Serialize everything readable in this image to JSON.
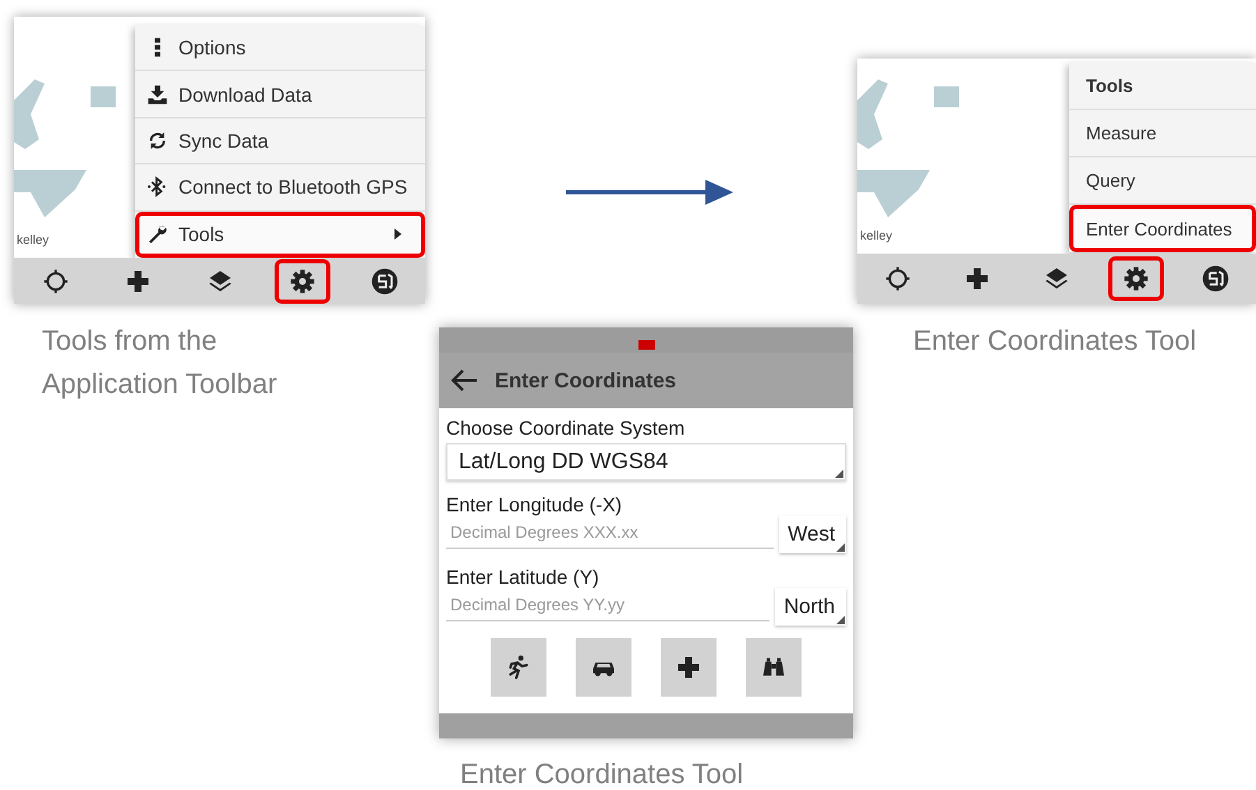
{
  "left_panel": {
    "map_label": "kelley",
    "menu": [
      {
        "kind": "options",
        "label": "Options",
        "highlighted": false,
        "submenu": false
      },
      {
        "kind": "download",
        "label": "Download Data",
        "highlighted": false,
        "submenu": false
      },
      {
        "kind": "sync",
        "label": "Sync Data",
        "highlighted": false,
        "submenu": false
      },
      {
        "kind": "bluetooth",
        "label": "Connect to Bluetooth GPS",
        "highlighted": false,
        "submenu": false
      },
      {
        "kind": "tools",
        "label": "Tools",
        "highlighted": true,
        "submenu": true
      }
    ],
    "toolbar": [
      {
        "kind": "locate",
        "highlighted": false
      },
      {
        "kind": "add",
        "highlighted": false
      },
      {
        "kind": "layers",
        "highlighted": false
      },
      {
        "kind": "settings",
        "highlighted": true
      },
      {
        "kind": "globe",
        "highlighted": false
      }
    ]
  },
  "left_caption": [
    "Tools from the",
    "Application Toolbar"
  ],
  "right_panel": {
    "map_label": "kelley",
    "menu": [
      {
        "kind": "header",
        "label": "Tools",
        "highlighted": false,
        "submenu": false
      },
      {
        "kind": "plain",
        "label": "Measure",
        "highlighted": false,
        "submenu": false
      },
      {
        "kind": "plain",
        "label": "Query",
        "highlighted": false,
        "submenu": false
      },
      {
        "kind": "plain",
        "label": "Enter Coordinates",
        "highlighted": true,
        "submenu": false
      }
    ],
    "toolbar": [
      {
        "kind": "locate",
        "highlighted": false
      },
      {
        "kind": "add",
        "highlighted": false
      },
      {
        "kind": "layers",
        "highlighted": false
      },
      {
        "kind": "settings",
        "highlighted": true
      },
      {
        "kind": "globe",
        "highlighted": false
      }
    ]
  },
  "right_caption": "Enter Coordinates Tool",
  "form_panel": {
    "title": "Enter Coordinates",
    "coordinate_system": {
      "label": "Choose Coordinate System",
      "value": "Lat/Long DD WGS84"
    },
    "longitude": {
      "label": "Enter Longitude (-X)",
      "placeholder": "Decimal Degrees XXX.xx",
      "direction": "West"
    },
    "latitude": {
      "label": "Enter Latitude (Y)",
      "placeholder": "Decimal Degrees YY.yy",
      "direction": "North"
    },
    "buttons": [
      {
        "kind": "walk"
      },
      {
        "kind": "car"
      },
      {
        "kind": "add"
      },
      {
        "kind": "binoculars"
      }
    ]
  },
  "form_caption": "Enter Coordinates Tool"
}
